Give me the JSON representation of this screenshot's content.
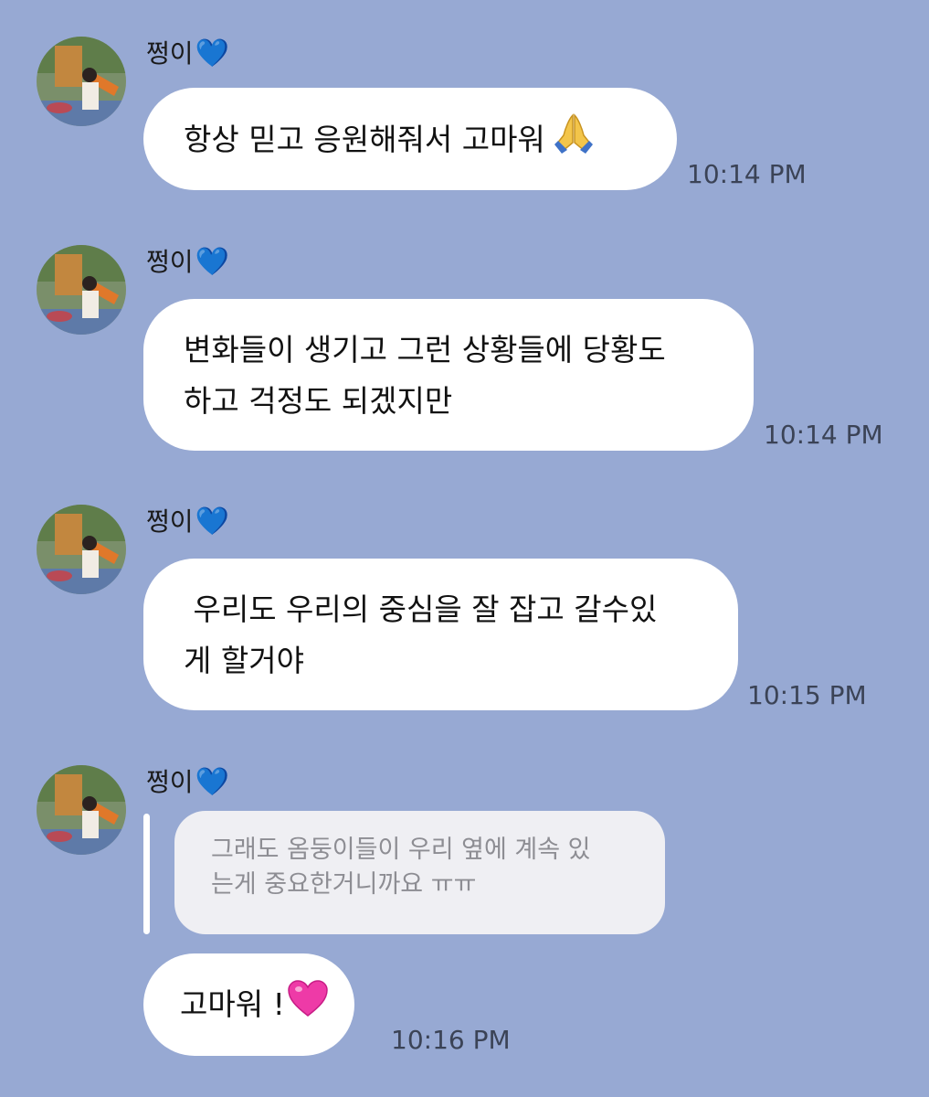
{
  "messages": [
    {
      "sender": "쩡이",
      "lines": [
        "항상 믿고 응원해줘서 고마워"
      ],
      "time": "10:14 PM"
    },
    {
      "sender": "쩡이",
      "lines": [
        "변화들이 생기고 그런 상황들에 당황도",
        "하고 걱정도 되겠지만"
      ],
      "time": "10:14 PM"
    },
    {
      "sender": "쩡이",
      "lines": [
        " 우리도 우리의 중심을 잘 잡고 갈수있",
        "게 할거야"
      ],
      "time": "10:15 PM"
    },
    {
      "sender": "쩡이",
      "quote_lines": [
        "그래도 옴둥이들이 우리 옆에 계속 있",
        "는게 중요한거니까요 ㅠㅠ"
      ],
      "lines": [
        "고마워 !"
      ],
      "time": "10:16 PM"
    }
  ],
  "icons": {
    "sender_badge": "blue-heart-emoji",
    "message1_emoji": "folded-hands-emoji",
    "message4_emoji": "pink-heart-emoji"
  },
  "colors": {
    "background": "#97a9d3",
    "bubble": "#ffffff",
    "quote_bubble": "#efeff3",
    "time_text": "#3b4356"
  }
}
